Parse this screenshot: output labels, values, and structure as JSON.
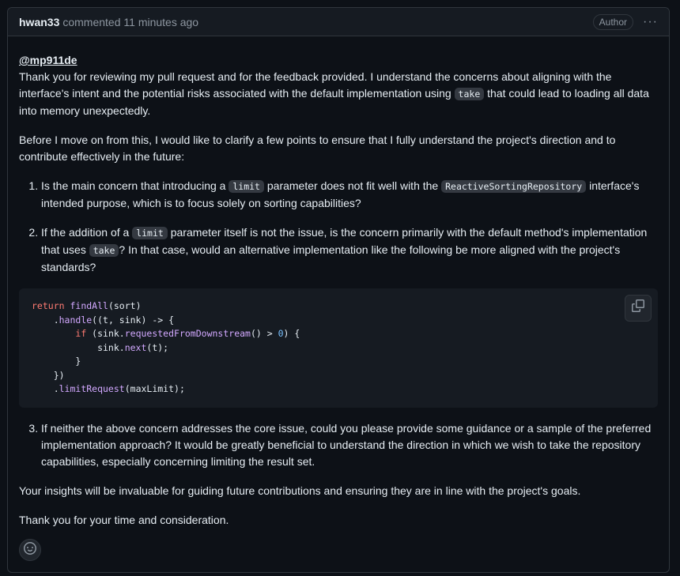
{
  "header": {
    "author": "hwan33",
    "meta": "commented 11 minutes ago",
    "badge": "Author",
    "kebab": "···"
  },
  "body": {
    "mention": "@mp911de",
    "para1_a": "Thank you for reviewing my pull request and for the feedback provided. I understand the concerns about aligning with the interface's intent and the potential risks associated with the default implementation using ",
    "para1_code": "take",
    "para1_b": " that could lead to loading all data into memory unexpectedly.",
    "para2": "Before I move on from this, I would like to clarify a few points to ensure that I fully understand the project's direction and to contribute effectively in the future:",
    "item1_a": "Is the main concern that introducing a ",
    "item1_code1": "limit",
    "item1_b": " parameter does not fit well with the ",
    "item1_code2": "ReactiveSortingRepository",
    "item1_c": " interface's intended purpose, which is to focus solely on sorting capabilities?",
    "item2_a": "If the addition of a ",
    "item2_code1": "limit",
    "item2_b": " parameter itself is not the issue, is the concern primarily with the default method's implementation that uses ",
    "item2_code2": "take",
    "item2_c": "? In that case, would an alternative implementation like the following be more aligned with the project's standards?",
    "item3": "If neither the above concern addresses the core issue, could you please provide some guidance or a sample of the preferred implementation approach? It would be greatly beneficial to understand the direction in which we wish to take the repository capabilities, especially concerning limiting the result set.",
    "para3": "Your insights will be invaluable for guiding future contributions and ensuring they are in line with the project's goals.",
    "para4": "Thank you for your time and consideration."
  },
  "code": {
    "l1_kw": "return",
    "l1_fn": "findAll",
    "l1_rest": "(sort)",
    "l2_pre": "    .",
    "l2_fn": "handle",
    "l2_rest": "((t, sink) -> {",
    "l3_pre": "        ",
    "l3_kw": "if",
    "l3_a": " (sink.",
    "l3_fn": "requestedFromDownstream",
    "l3_b": "() > ",
    "l3_num": "0",
    "l3_c": ") {",
    "l4_pre": "            sink.",
    "l4_fn": "next",
    "l4_rest": "(t);",
    "l5": "        }",
    "l6": "    })",
    "l7_pre": "    .",
    "l7_fn": "limitRequest",
    "l7_rest": "(maxLimit);"
  },
  "icons": {
    "copy": "copy-icon",
    "smiley": "smiley-icon"
  }
}
